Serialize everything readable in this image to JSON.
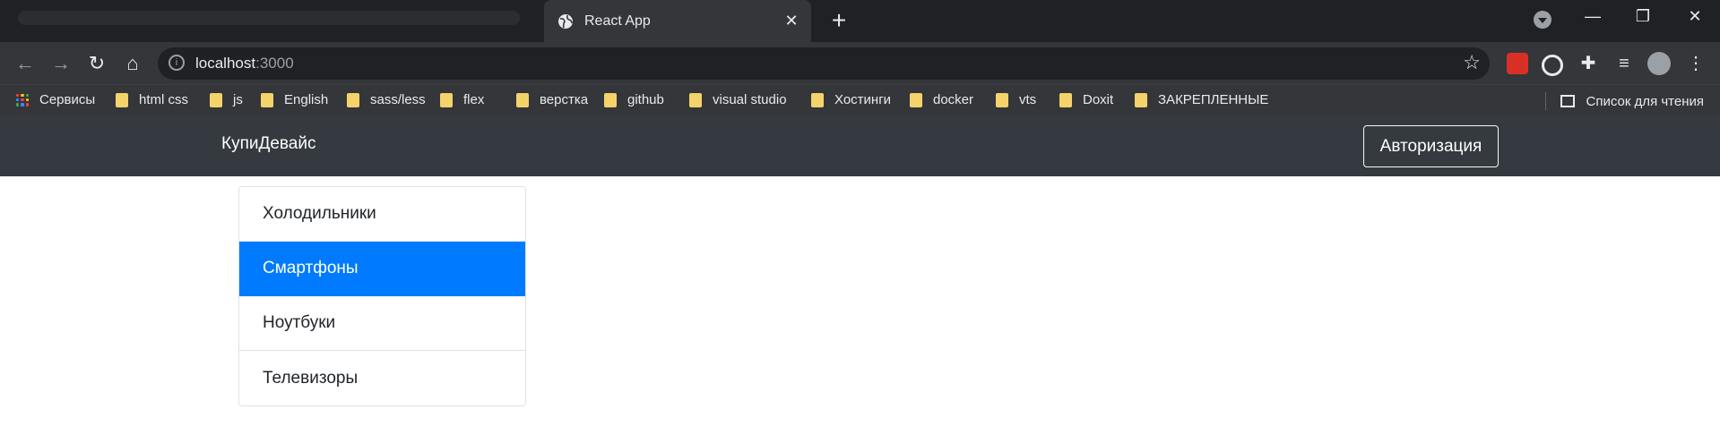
{
  "browser": {
    "tab_title": "React App",
    "tab_close_icon": "close-icon",
    "new_tab_icon": "plus-icon",
    "url_host": "localhost",
    "url_port": ":3000",
    "bookmarks": [
      {
        "label": "Сервисы",
        "icon": "apps-grid-icon"
      },
      {
        "label": "html css",
        "icon": "folder-icon"
      },
      {
        "label": "js",
        "icon": "folder-icon"
      },
      {
        "label": "English",
        "icon": "folder-icon"
      },
      {
        "label": "sass/less",
        "icon": "folder-icon"
      },
      {
        "label": "flex",
        "icon": "folder-icon"
      },
      {
        "label": "верстка",
        "icon": "folder-icon"
      },
      {
        "label": "github",
        "icon": "folder-icon"
      },
      {
        "label": "visual studio",
        "icon": "folder-icon"
      },
      {
        "label": "Хостинги",
        "icon": "folder-icon"
      },
      {
        "label": "docker",
        "icon": "folder-icon"
      },
      {
        "label": "vts",
        "icon": "folder-icon"
      },
      {
        "label": "Doxit",
        "icon": "folder-icon"
      },
      {
        "label": "ЗАКРЕПЛЕННЫЕ",
        "icon": "folder-icon"
      }
    ],
    "reading_list": "Список для чтения"
  },
  "app": {
    "brand": "КупиДевайс",
    "auth_button": "Авторизация",
    "types": [
      {
        "label": "Холодильники",
        "active": false
      },
      {
        "label": "Смартфоны",
        "active": true
      },
      {
        "label": "Ноутбуки",
        "active": false
      },
      {
        "label": "Телевизоры",
        "active": false
      }
    ]
  },
  "colors": {
    "navbar": "#343a40",
    "active_item": "#007bff",
    "chrome_dark": "#202124",
    "chrome_toolbar": "#35363a"
  }
}
